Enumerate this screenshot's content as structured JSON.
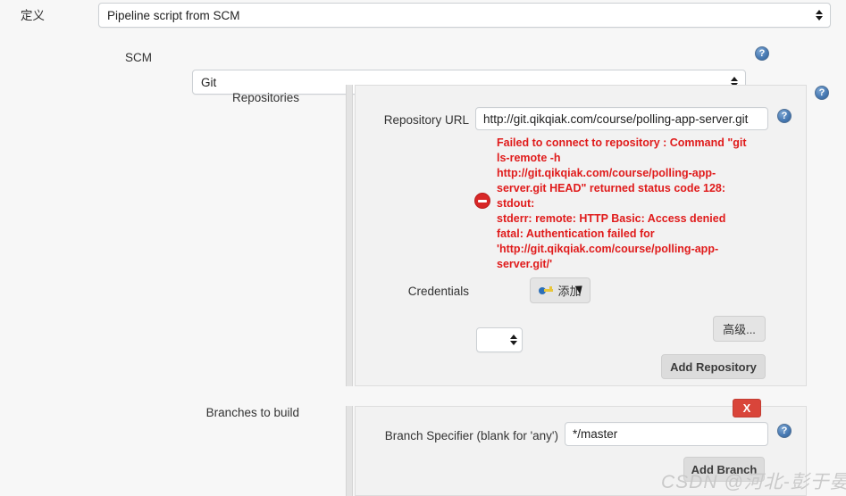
{
  "definition": {
    "label": "定义",
    "value": "Pipeline script from SCM"
  },
  "scm": {
    "label": "SCM",
    "value": "Git",
    "help_icon": "help-icon"
  },
  "repositories": {
    "label": "Repositories",
    "help_icon": "help-icon",
    "repository_url": {
      "label": "Repository URL",
      "value": "http://git.qikqiak.com/course/polling-app-server.git",
      "help_icon": "help-icon"
    },
    "error": {
      "icon": "error-icon",
      "text": "Failed to connect to repository : Command \"git ls-remote -h http://git.qikqiak.com/course/polling-app-server.git HEAD\" returned status code 128:\nstdout:\nstderr: remote: HTTP Basic: Access denied\nfatal: Authentication failed for 'http://git.qikqiak.com/course/polling-app-server.git'",
      "color": "#e01b1b",
      "lines": [
        "Failed to connect to repository : Command \"git",
        "ls-remote -h",
        "http://git.qikqiak.com/course/polling-app-",
        "server.git HEAD\" returned status code 128:",
        "stdout:",
        "stderr: remote: HTTP Basic: Access denied",
        "fatal: Authentication failed for",
        "'http://git.qikqiak.com/course/polling-app-",
        "server.git/'"
      ]
    },
    "credentials": {
      "label": "Credentials",
      "value": "",
      "add_button": {
        "label": "添加",
        "icon": "key-icon"
      }
    },
    "advanced_button": "高级...",
    "add_repository_button": "Add Repository"
  },
  "branches": {
    "label": "Branches to build",
    "delete_button": "X",
    "branch_specifier": {
      "label": "Branch Specifier (blank for 'any')",
      "value": "*/master",
      "help_icon": "help-icon"
    },
    "add_branch_button": "Add Branch"
  },
  "watermark": "CSDN @河北-彭于晏",
  "colors": {
    "error_red": "#e01b1b",
    "delete_red": "#d9453a",
    "help_blue": "#4a7cb5",
    "panel_bg": "#f2f2f2",
    "page_bg": "#f7f7f7"
  }
}
